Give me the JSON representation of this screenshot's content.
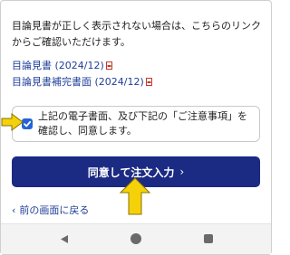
{
  "intro_text": "目論見書が正しく表示されない場合は、こちらのリンクからご確認いただけます。",
  "links": [
    {
      "label": "目論見書 (2024/12)",
      "icon": "pdf-icon"
    },
    {
      "label": "目論見書補完書面 (2024/12)",
      "icon": "pdf-icon"
    }
  ],
  "consent": {
    "checked": true,
    "text": "上記の電子書面、及び下記の「ご注意事項」を確認し、同意します。"
  },
  "primary_button": {
    "label": "同意して注文入力",
    "chevron": "›"
  },
  "back_link": {
    "label": "前の画面に戻る",
    "chevron": "‹"
  },
  "colors": {
    "primary": "#1b2a82",
    "link": "#1f3f98",
    "checkbox": "#2563d6",
    "annotation_arrow": "#f5d10a"
  },
  "system_nav": [
    "back-triangle-icon",
    "home-circle-icon",
    "recent-square-icon"
  ]
}
